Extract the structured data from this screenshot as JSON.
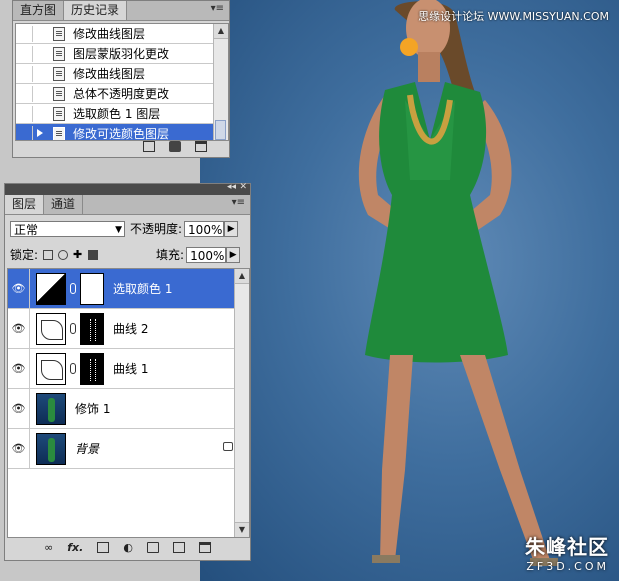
{
  "watermark_top": "思缘设计论坛 WWW.MISSYUAN.COM",
  "watermark_bottom": {
    "big": "朱峰社区",
    "small": "ZF3D.COM"
  },
  "history_panel": {
    "tabs": [
      "直方图",
      "历史记录"
    ],
    "active_tab": 1,
    "items": [
      "修改曲线图层",
      "图层蒙版羽化更改",
      "修改曲线图层",
      "总体不透明度更改",
      "选取颜色 1 图层",
      "修改可选颜色图层"
    ],
    "selected_index": 5
  },
  "layers_panel": {
    "tabs": [
      "图层",
      "通道"
    ],
    "active_tab": 0,
    "blend_mode": "正常",
    "opacity_label": "不透明度:",
    "opacity_value": "100%",
    "lock_label": "锁定:",
    "fill_label": "填充:",
    "fill_value": "100%",
    "layers": [
      {
        "name": "选取颜色 1",
        "thumb": "selective-color",
        "mask": "white",
        "selected": true
      },
      {
        "name": "曲线 2",
        "thumb": "curves",
        "mask": "black",
        "selected": false
      },
      {
        "name": "曲线 1",
        "thumb": "curves",
        "mask": "black",
        "selected": false
      },
      {
        "name": "修饰 1",
        "thumb": "photo",
        "mask": "",
        "selected": false
      },
      {
        "name": "背景",
        "thumb": "photo",
        "mask": "",
        "selected": false,
        "locked": true
      }
    ],
    "footer_icons": [
      "link-icon",
      "fx-icon",
      "mask-icon",
      "adjustment-icon",
      "folder-icon",
      "new-layer-icon",
      "trash-icon"
    ],
    "footer_text_fx": "fx."
  },
  "colors": {
    "selection": "#3a6ad1",
    "background_photo": "#3f6e9e"
  }
}
